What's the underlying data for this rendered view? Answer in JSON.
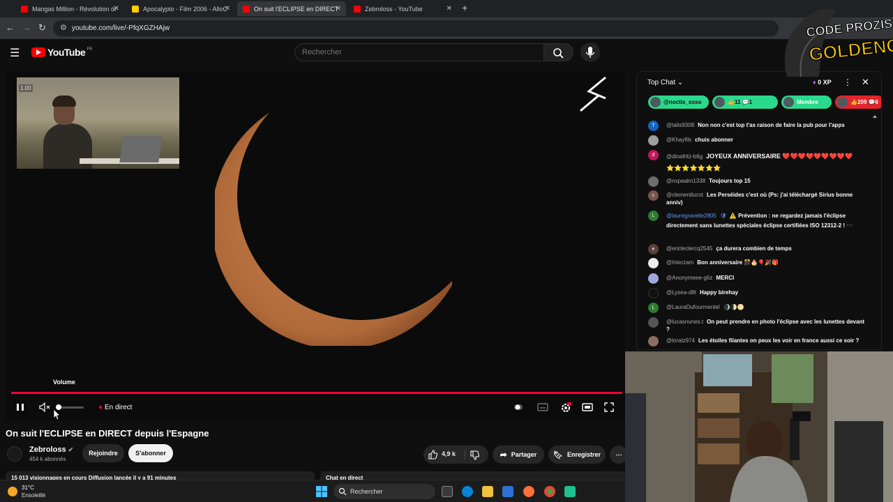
{
  "browser": {
    "tabs": [
      {
        "label": "Mangas Million - Révolution de",
        "favicon_color": "#ff0000"
      },
      {
        "label": "Apocalypto - Film 2006 - AlloC",
        "favicon_color": "#ffcc00"
      },
      {
        "label": "On suit l'ECLIPSE en DIRECT de",
        "favicon_color": "#ff0000",
        "active": true
      },
      {
        "label": "Zebroloss - YouTube",
        "favicon_color": "#ff0000"
      }
    ],
    "url": "youtube.com/live/-PfqXGZHAjw"
  },
  "youtube": {
    "logo_text": "YouTube",
    "country_code": "FR",
    "search_placeholder": "Rechercher"
  },
  "player": {
    "pip_label": "1.00",
    "volume_tooltip": "Volume",
    "live_label": "En direct",
    "volume_level": 0
  },
  "video": {
    "title": "On suit l'ECLIPSE en DIRECT depuis l'Espagne",
    "channel_name": "Zebroloss",
    "subscribers": "454 k abonnés",
    "join_label": "Rejoindre",
    "subscribe_label": "S'abonner",
    "likes": "4,9 k",
    "share_label": "Partager",
    "save_label": "Enregistrer",
    "views_line": "15 013 visionnages en cours  Diffusion lancée il y a 91 minutes",
    "chat_live_label": "Chat en direct"
  },
  "chat": {
    "title": "Top Chat",
    "xp": "0 XP",
    "chips": [
      {
        "label": "@noctis_xoxo",
        "bg": "#2bd98b"
      },
      {
        "label": "👍11  💬1",
        "bg": "#2bd98b"
      },
      {
        "label": "Membre",
        "bg": "#2bd98b"
      },
      {
        "label": "👍209  💬6",
        "bg": "#e3242b"
      }
    ],
    "messages": [
      {
        "author": "@talis9308",
        "text": "Non non c'est top t'as raison de faire la pub pour l'apps",
        "avatar": "T",
        "avatar_bg": "#1565c0"
      },
      {
        "author": "@Khayfils",
        "text": "chuis abonner",
        "avatar": "",
        "avatar_bg": "#9e9e9e"
      },
      {
        "author": "@dinafritz-b6g",
        "text": "JOYEUX ANNIVERSAIRE ❤️❤️❤️❤️❤️❤️❤️❤️❤️⭐⭐⭐⭐⭐⭐⭐",
        "avatar": "d",
        "avatar_bg": "#c2185b"
      },
      {
        "author": "@nxpaalm1338",
        "text": "Toujours top 15",
        "avatar": "",
        "avatar_bg": "#6d6d6d"
      },
      {
        "author": "@clementlucot",
        "text": "Les Perséides c'est où (Ps: j'ai téléchargé Sirius bonne anniv)",
        "avatar": "c",
        "avatar_bg": "#795548"
      },
      {
        "author": "@lauregravelle2805",
        "text": "⚠️ Prévention : ne regardez jamais l'éclipse directement sans lunettes spéciales éclipse certifiées ISO 12312-2 ! 🕶️",
        "avatar": "L",
        "avatar_bg": "#2e7d32",
        "moderator": true
      },
      {
        "author": "@ericleclercq2545",
        "text": "ça durera combien de temps",
        "avatar": "e",
        "avatar_bg": "#5d4037"
      },
      {
        "author": "@Interzam",
        "text": "Bon anniversaire 🎊🎂🎈🎉🎁",
        "avatar": "",
        "avatar_bg": "#eeeeee"
      },
      {
        "author": "@Anonymeee-g6z",
        "text": "MERCI",
        "avatar": "",
        "avatar_bg": "#9fa8da"
      },
      {
        "author": "@Lysea-d8t",
        "text": "Happy birehay",
        "avatar": "",
        "avatar_bg": "#111111"
      },
      {
        "author": "@LauraDufourmentel",
        "text": "🌒🌓🌕",
        "avatar": "L",
        "avatar_bg": "#2e7d32"
      },
      {
        "author": "@lucasnunes.t",
        "text": "On peut prendre en photo l'éclipse avec les lunettes devant ?",
        "avatar": "",
        "avatar_bg": "#555555"
      },
      {
        "author": "@loratz974",
        "text": "Les étoiles filantes on peux les voir en france aussi ce soir ?",
        "avatar": "",
        "avatar_bg": "#8d6e63"
      }
    ]
  },
  "overlay": {
    "line1": "CODE PROZIS",
    "line2": "GOLDENG"
  },
  "taskbar": {
    "temperature": "31°C",
    "weather": "Ensoleillé",
    "search_label": "Rechercher"
  }
}
